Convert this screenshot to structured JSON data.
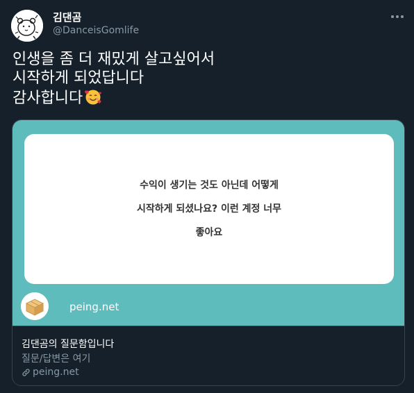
{
  "user": {
    "display_name": "김댄곰",
    "handle": "@DanceisGomlife",
    "avatar_icon": "bear-avatar-icon"
  },
  "more_icon": "more-horizontal-icon",
  "tweet": {
    "lines": [
      "인생을 좀 더 재밌게 살고싶어서",
      "시작하게 되었답니다",
      "감사합니다"
    ],
    "emoji": "smiling-face-with-hearts-icon"
  },
  "card": {
    "image_bg_color": "#5fbcbc",
    "question_lines": [
      "수익이 생기는 것도 아닌데 어떻게",
      "시작하게 되셨나요? 이런 계정 너무",
      "좋아요"
    ],
    "site_logo_icon": "cardboard-box-icon",
    "image_domain": "peing.net",
    "title": "김댄곰의 질문함입니다",
    "description": "질문/답변은 여기",
    "link_domain": "peing.net",
    "link_icon": "link-icon"
  },
  "colors": {
    "background": "#15202b",
    "secondary_text": "#8899a6",
    "border": "#38444d"
  }
}
